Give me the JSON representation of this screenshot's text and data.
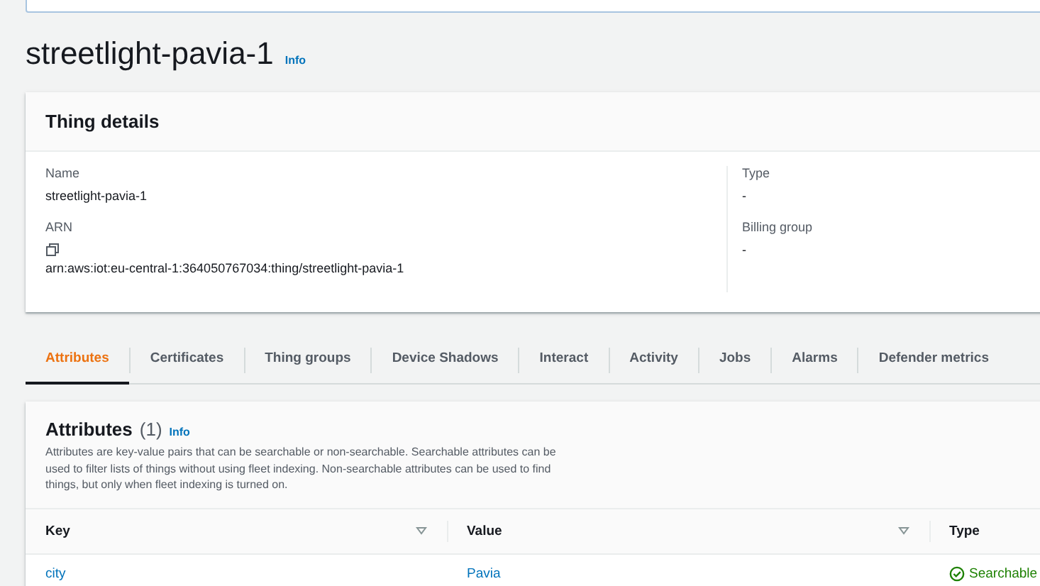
{
  "page": {
    "title": "streetlight-pavia-1",
    "info": "Info"
  },
  "details": {
    "title": "Thing details",
    "left": [
      {
        "label": "Name",
        "value": "streetlight-pavia-1",
        "copy": false
      },
      {
        "label": "ARN",
        "value": "arn:aws:iot:eu-central-1:364050767034:thing/streetlight-pavia-1",
        "copy": true
      }
    ],
    "right": [
      {
        "label": "Type",
        "value": "-",
        "copy": false
      },
      {
        "label": "Billing group",
        "value": "-",
        "copy": false
      }
    ]
  },
  "tabs": [
    {
      "label": "Attributes",
      "selected": true
    },
    {
      "label": "Certificates",
      "selected": false
    },
    {
      "label": "Thing groups",
      "selected": false
    },
    {
      "label": "Device Shadows",
      "selected": false
    },
    {
      "label": "Interact",
      "selected": false
    },
    {
      "label": "Activity",
      "selected": false
    },
    {
      "label": "Jobs",
      "selected": false
    },
    {
      "label": "Alarms",
      "selected": false
    },
    {
      "label": "Defender metrics",
      "selected": false
    }
  ],
  "attributes": {
    "title": "Attributes",
    "count": "(1)",
    "info": "Info",
    "description": "Attributes are key-value pairs that can be searchable or non-searchable. Searchable attributes can be used to filter lists of things without using fleet indexing. Non-searchable attributes can be used to find things, but only when fleet indexing is turned on.",
    "columns": [
      {
        "label": "Key",
        "sortable": true
      },
      {
        "label": "Value",
        "sortable": true
      },
      {
        "label": "Type"
      }
    ],
    "rows": [
      {
        "key": "city",
        "value": "Pavia",
        "type": "Searchable",
        "kind": "success"
      }
    ]
  }
}
